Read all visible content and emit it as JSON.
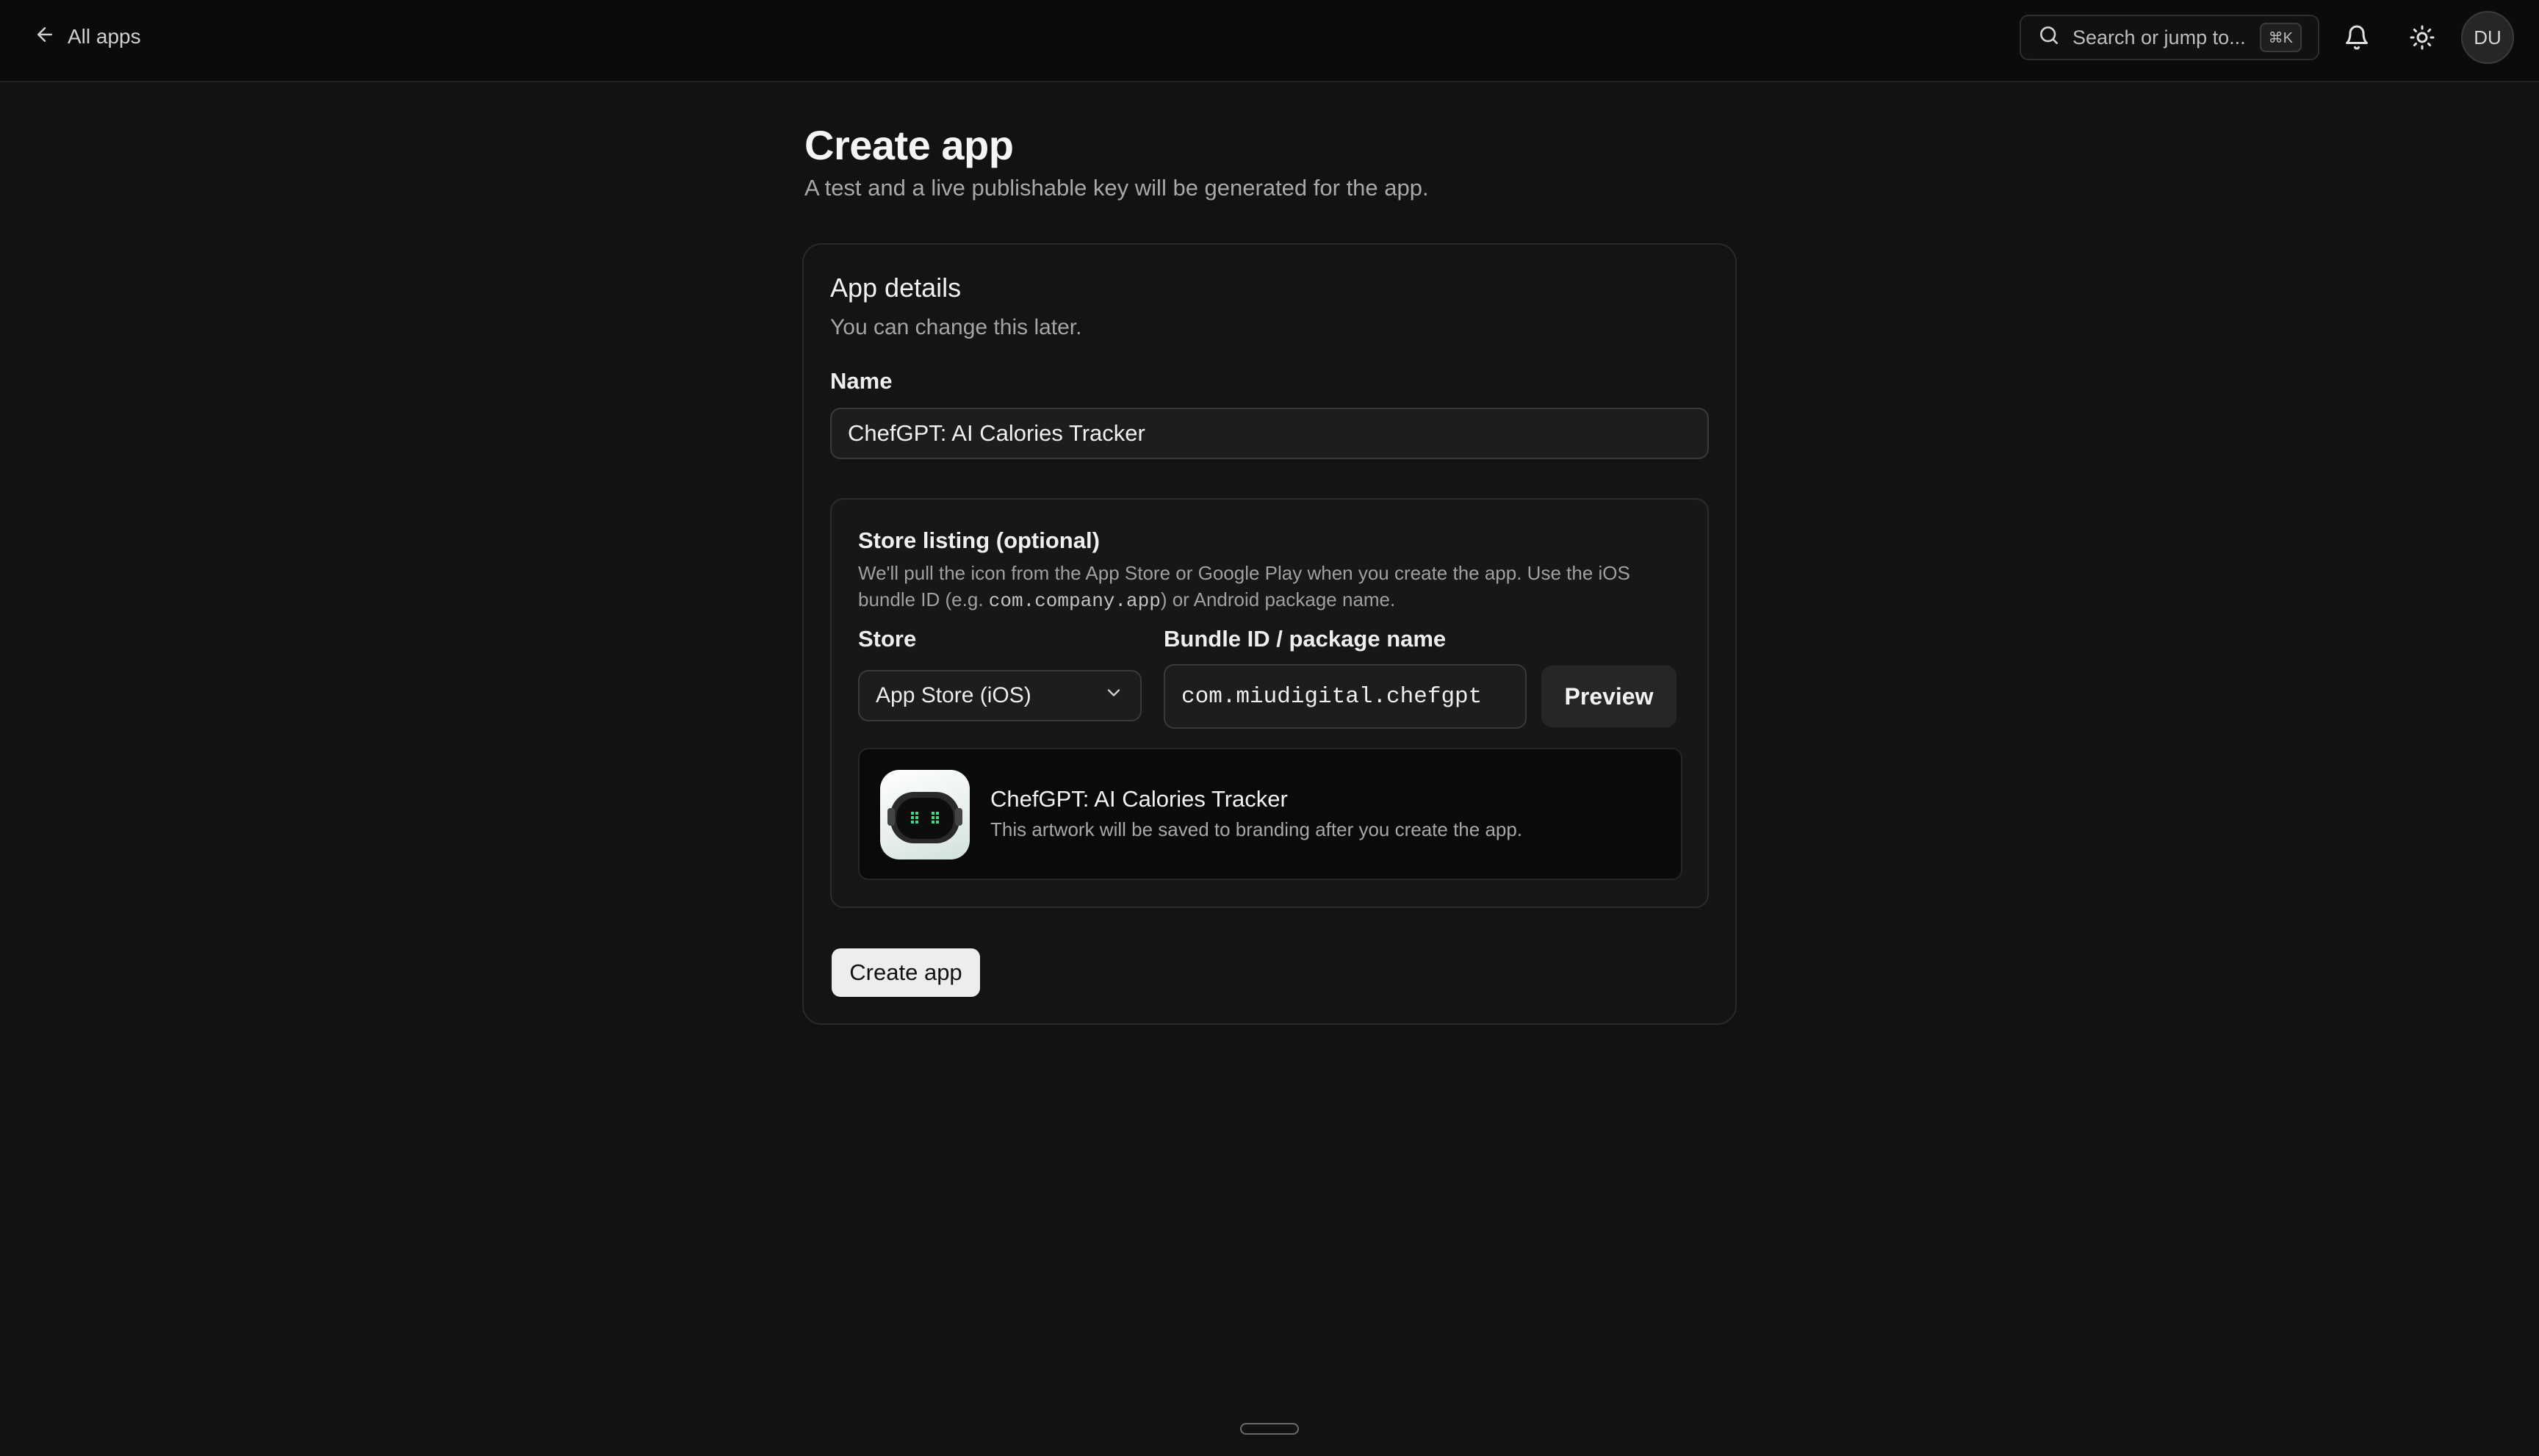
{
  "topbar": {
    "back_label": "All apps",
    "search_placeholder": "Search or jump to...",
    "search_shortcut": "⌘K",
    "avatar_initials": "DU"
  },
  "page": {
    "title": "Create app",
    "subtitle": "A test and a live publishable key will be generated for the app."
  },
  "app_details": {
    "title": "App details",
    "subtitle": "You can change this later.",
    "name_label": "Name",
    "name_value": "ChefGPT: AI Calories Tracker"
  },
  "store_listing": {
    "title": "Store listing (optional)",
    "desc_part1": "We'll pull the icon from the App Store or Google Play when you create the app. Use the iOS bundle ID (e.g. ",
    "desc_code": "com.company.app",
    "desc_part2": ") or Android package name.",
    "store_label": "Store",
    "store_value": "App Store (iOS)",
    "bundle_label": "Bundle ID / package name",
    "bundle_value": "com.miudigital.chefgpt",
    "preview_label": "Preview",
    "preview_app_name": "ChefGPT: AI Calories Tracker",
    "preview_note": "This artwork will be saved to branding after you create the app."
  },
  "actions": {
    "create_label": "Create app"
  },
  "colors": {
    "background": "#121212",
    "topbar": "#0b0b0b",
    "primary_button": "#ededed",
    "accent_green": "#3ddc84"
  },
  "icons": [
    "arrow-left-icon",
    "search-icon",
    "bell-icon",
    "sun-icon",
    "chevron-down-icon"
  ]
}
